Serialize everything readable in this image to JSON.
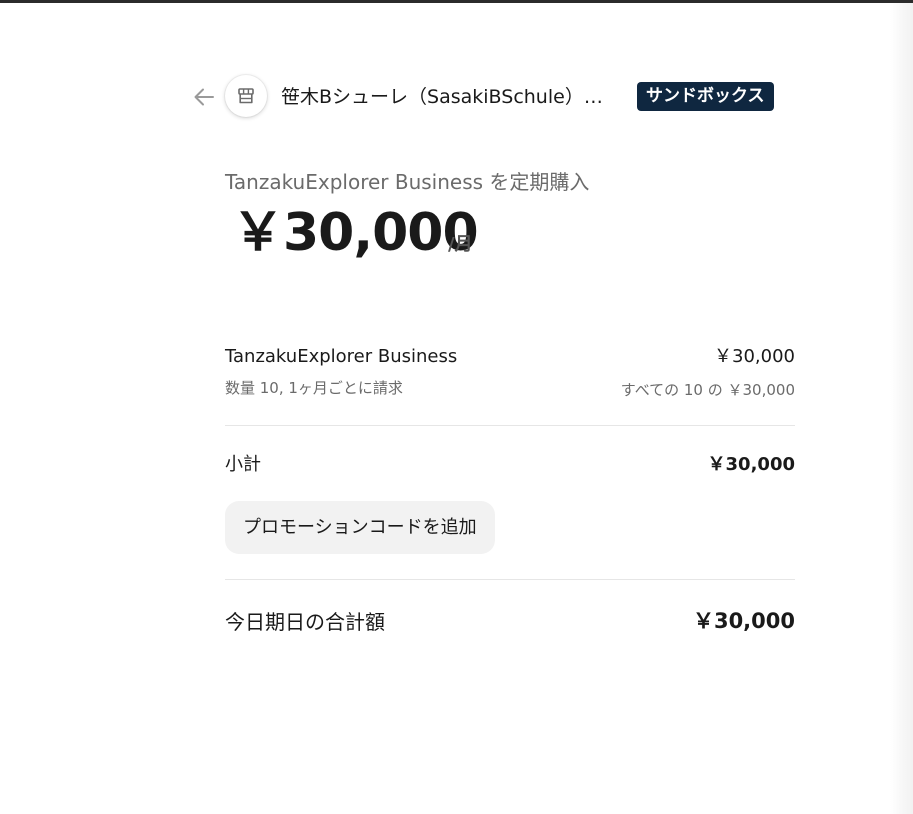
{
  "header": {
    "back_icon": "arrow-left-icon",
    "avatar_icon": "store-icon",
    "merchant_name": "笹木Bシューレ（SasakiBSchule）サン...",
    "badge": "サンドボックス",
    "badge_color": "#0f2740"
  },
  "summary": {
    "title": "TanzakuExplorer Business を定期購入",
    "price": "￥30,000",
    "interval": "/月"
  },
  "line_item": {
    "name": "TanzakuExplorer Business",
    "price": "￥30,000",
    "detail": "数量 10, 1ヶ月ごとに請求",
    "unit_detail": "すべての 10 の ￥30,000"
  },
  "subtotal": {
    "label": "小計",
    "value": "￥30,000"
  },
  "promo": {
    "label": "プロモーションコードを追加"
  },
  "total": {
    "label": "今日期日の合計額",
    "value": "￥30,000"
  }
}
